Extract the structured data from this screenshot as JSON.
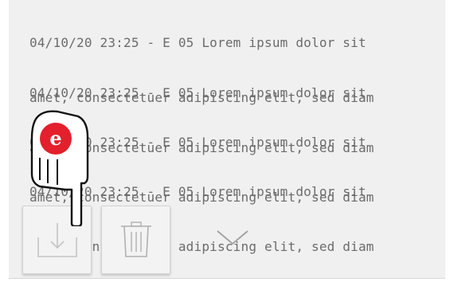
{
  "log": {
    "entries": [
      {
        "line1": "04/10/20 23:25 - E 05 Lorem ipsum dolor sit",
        "line2": "amet, consectetuer adipiscing elit, sed diam"
      },
      {
        "line1": "04/10/20 23:25 - E 05 Lorem ipsum dolor sit",
        "line2": "amet, consectetuer adipiscing elit, sed diam"
      },
      {
        "line1": "04/10/20 23:25 - E 05 Lorem ipsum dolor sit",
        "line2": "amet, consectetuer adipiscing elit, sed diam"
      },
      {
        "line1": "04/10/20 23:25 - E 05 Lorem ipsum dolor sit",
        "line2": "amet, consectetuer adipiscing elit, sed diam"
      }
    ]
  },
  "toolbar": {
    "download_icon": "download-tray-icon",
    "delete_icon": "trash-icon",
    "expand_icon": "chevron-down-icon"
  },
  "overlay": {
    "pointer_icon": "hand-pointer-icon",
    "badge_letter": "e",
    "badge_color": "#e3202c"
  }
}
